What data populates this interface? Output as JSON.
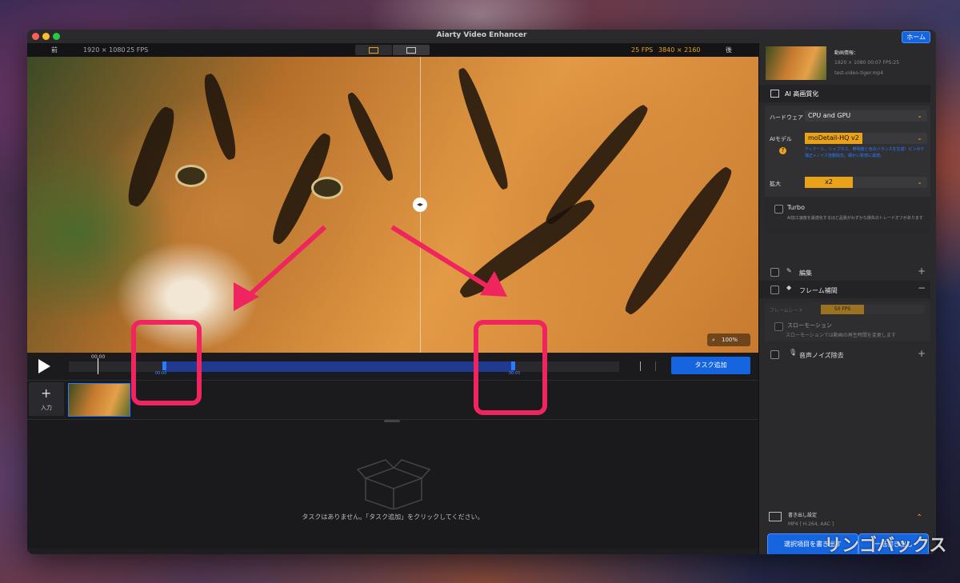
{
  "window": {
    "title": "Aiarty Video Enhancer",
    "home_label": "ホーム"
  },
  "infobar": {
    "before_label": "前",
    "before_res": "1920 × 1080",
    "before_fps": "25 FPS",
    "after_fps": "25 FPS",
    "after_res": "3840 × 2160",
    "after_label": "後"
  },
  "preview": {
    "zoom": "100%"
  },
  "timeline": {
    "time_top": "00:00",
    "marker_start": "00:00",
    "marker_end": "00:05",
    "add_task_label": "タスク追加"
  },
  "strip": {
    "add_label": "入力"
  },
  "tasks": {
    "empty_message": "タスクはありません。「タスク追加」をクリックしてください。"
  },
  "side": {
    "video_info_title": "動画情報：",
    "video_info_meta": "1920 × 1080  00:07  FPS:25",
    "video_filename": "test-video-tiger.mp4",
    "ai_section": "AI 高画質化",
    "hardware_label": "ハードウェア",
    "hardware_value": "CPU and GPU",
    "model_label": "AIモデル",
    "model_value": "moDetail-HQ  v2",
    "model_desc": "ディテール、シャプネス、鮮明度と色のバランスを生成！ピンボケ補正+ノイズ自動除去。細かい質感に最適。",
    "scale_label": "拡大",
    "scale_value": "x2",
    "turbo_label": "Turbo",
    "turbo_desc": "AI加工速度を最適化するほど品質がわずかな損失のトレードオフがあります",
    "edit_label": "編集",
    "frame_label": "フレーム補間",
    "framerate_label": "フレームレート",
    "framerate_value": "50 FPS",
    "slowmo_label": "スローモーション",
    "slowmo_desc": "スローモーションでは動画の再生時間を変更します",
    "denoise_label": "音声ノイズ除去",
    "export_title": "書き出し設定",
    "export_format": "MP4 [ H.264, AAC ]",
    "export_selected": "選択項目を書き出す",
    "export_all": "一括書き出し"
  },
  "watermark": "リンゴバックス",
  "colors": {
    "accent": "#1565e0",
    "highlight": "#f0245f",
    "warning": "#e9a21a"
  }
}
